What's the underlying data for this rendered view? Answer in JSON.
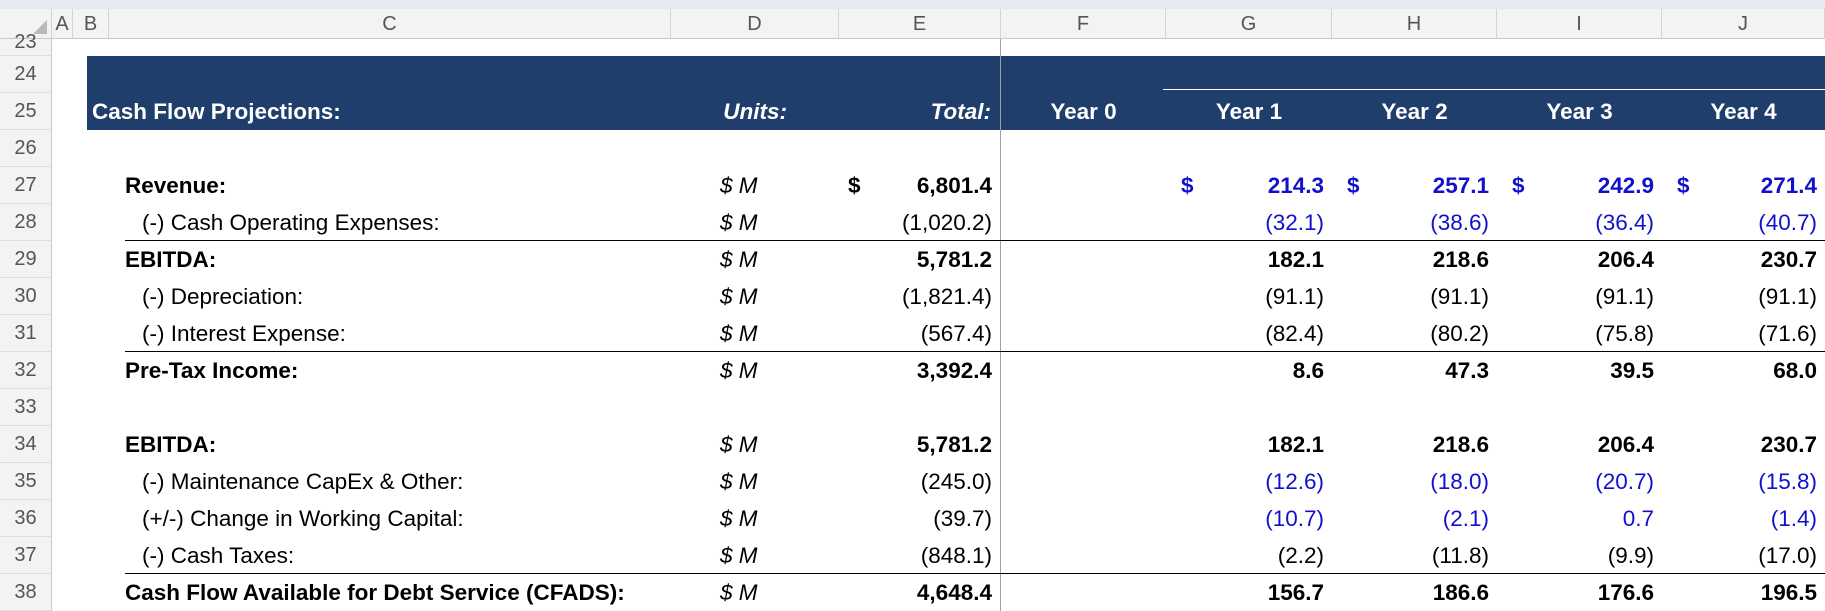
{
  "columns": [
    "A",
    "B",
    "C",
    "D",
    "E",
    "F",
    "G",
    "H",
    "I",
    "J"
  ],
  "row_numbers": [
    "23",
    "24",
    "25",
    "26",
    "27",
    "28",
    "29",
    "30",
    "31",
    "32",
    "33",
    "34",
    "35",
    "36",
    "37",
    "38"
  ],
  "header": {
    "title": "Cash Flow Projections:",
    "units": "Units:",
    "total": "Total:",
    "years": [
      "Year 0",
      "Year 1",
      "Year 2",
      "Year 3",
      "Year 4"
    ]
  },
  "currency": "$",
  "rows": [
    {
      "label": "Revenue:",
      "units": "$ M",
      "total": "6,801.4",
      "values": [
        "214.3",
        "257.1",
        "242.9",
        "271.4"
      ],
      "bold": true,
      "blue": true,
      "dollar": true
    },
    {
      "label": "(-) Cash Operating Expenses:",
      "units": "$ M",
      "total": "(1,020.2)",
      "values": [
        "(32.1)",
        "(38.6)",
        "(36.4)",
        "(40.7)"
      ],
      "bold": false,
      "blue": true
    },
    {
      "label": "EBITDA:",
      "units": "$ M",
      "total": "5,781.2",
      "values": [
        "182.1",
        "218.6",
        "206.4",
        "230.7"
      ],
      "bold": true,
      "blue": false
    },
    {
      "label": "(-) Depreciation:",
      "units": "$ M",
      "total": "(1,821.4)",
      "values": [
        "(91.1)",
        "(91.1)",
        "(91.1)",
        "(91.1)"
      ],
      "bold": false,
      "blue": false
    },
    {
      "label": "(-) Interest Expense:",
      "units": "$ M",
      "total": "(567.4)",
      "values": [
        "(82.4)",
        "(80.2)",
        "(75.8)",
        "(71.6)"
      ],
      "bold": false,
      "blue": false
    },
    {
      "label": "Pre-Tax Income:",
      "units": "$ M",
      "total": "3,392.4",
      "values": [
        "8.6",
        "47.3",
        "39.5",
        "68.0"
      ],
      "bold": true,
      "blue": false
    },
    {
      "label": "EBITDA:",
      "units": "$ M",
      "total": "5,781.2",
      "values": [
        "182.1",
        "218.6",
        "206.4",
        "230.7"
      ],
      "bold": true,
      "blue": false
    },
    {
      "label": "(-) Maintenance CapEx & Other:",
      "units": "$ M",
      "total": "(245.0)",
      "values": [
        "(12.6)",
        "(18.0)",
        "(20.7)",
        "(15.8)"
      ],
      "bold": false,
      "blue": true
    },
    {
      "label": "(+/-) Change in Working Capital:",
      "units": "$ M",
      "total": "(39.7)",
      "values": [
        "(10.7)",
        "(2.1)",
        "0.7",
        "(1.4)"
      ],
      "bold": false,
      "blue": true
    },
    {
      "label": "(-) Cash Taxes:",
      "units": "$ M",
      "total": "(848.1)",
      "values": [
        "(2.2)",
        "(11.8)",
        "(9.9)",
        "(17.0)"
      ],
      "bold": false,
      "blue": false
    },
    {
      "label": "Cash Flow Available for Debt Service (CFADS):",
      "units": "$ M",
      "total": "4,648.4",
      "values": [
        "156.7",
        "186.6",
        "176.6",
        "196.5"
      ],
      "bold": true,
      "blue": false
    }
  ],
  "colors": {
    "banner": "#1f3e6b",
    "input_blue": "#1111cc"
  }
}
